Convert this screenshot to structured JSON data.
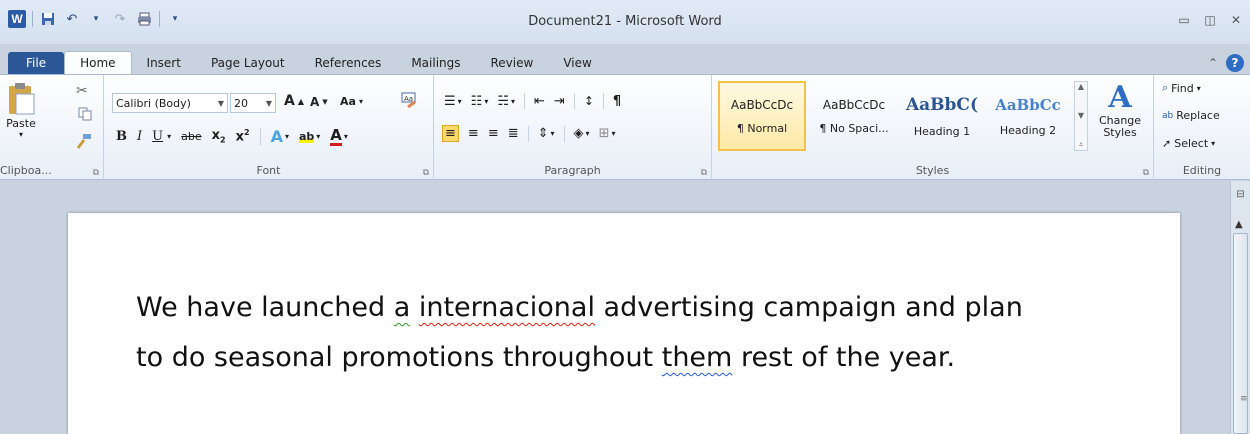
{
  "window": {
    "title": "Document21 - Microsoft Word"
  },
  "qat": {
    "logo": "W"
  },
  "tabs": [
    "File",
    "Home",
    "Insert",
    "Page Layout",
    "References",
    "Mailings",
    "Review",
    "View"
  ],
  "clipboard": {
    "paste_label": "Paste",
    "group_label": "Clipboa..."
  },
  "font": {
    "name": "Calibri (Body)",
    "size": "20",
    "group_label": "Font",
    "change_case": "Aa",
    "bold": "B",
    "italic": "I",
    "underline": "U",
    "strike": "abe",
    "sub": "x",
    "sup": "x"
  },
  "paragraph": {
    "group_label": "Paragraph"
  },
  "styles": {
    "group_label": "Styles",
    "items": [
      {
        "sample": "AaBbCcDc",
        "name": "¶ Normal"
      },
      {
        "sample": "AaBbCcDc",
        "name": "¶ No Spaci..."
      },
      {
        "sample": "AaBbC(",
        "name": "Heading 1"
      },
      {
        "sample": "AaBbCc",
        "name": "Heading 2"
      }
    ],
    "change_styles": "Change Styles"
  },
  "editing": {
    "group_label": "Editing",
    "find": "Find",
    "replace": "Replace",
    "select": "Select"
  },
  "document": {
    "line1_a": "We have launched ",
    "line1_b": "a",
    "line1_c": " ",
    "line1_d": "internacional",
    "line1_e": " advertising campaign and plan",
    "line2_a": "to do seasonal promotions throughout ",
    "line2_b": "them",
    "line2_c": " rest of the year."
  },
  "colors": {
    "file_tab": "#2b5797",
    "selected_style": "#f0c14b",
    "spell_red": "#d21",
    "grammar_green": "#2a9a2a",
    "context_blue": "#2a58d8"
  }
}
